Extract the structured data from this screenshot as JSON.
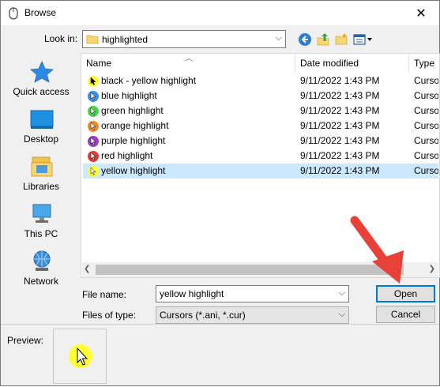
{
  "window": {
    "title": "Browse",
    "close_glyph": "✕"
  },
  "look_in": {
    "label": "Look in:",
    "value": "highlighted"
  },
  "places": [
    {
      "label": "Quick access",
      "icon": "star-icon"
    },
    {
      "label": "Desktop",
      "icon": "desktop-icon"
    },
    {
      "label": "Libraries",
      "icon": "libraries-icon"
    },
    {
      "label": "This PC",
      "icon": "pc-icon"
    },
    {
      "label": "Network",
      "icon": "network-icon"
    }
  ],
  "columns": {
    "name": "Name",
    "date": "Date modified",
    "type": "Type"
  },
  "files": [
    {
      "name": "black - yellow highlight",
      "date": "9/11/2022 1:43 PM",
      "type": "Cursor",
      "color": "#ffff33",
      "pointer": "#000000"
    },
    {
      "name": "blue highlight",
      "date": "9/11/2022 1:43 PM",
      "type": "Cursor",
      "color": "#3a8ee6",
      "pointer": "#ffffff"
    },
    {
      "name": "green highlight",
      "date": "9/11/2022 1:43 PM",
      "type": "Cursor",
      "color": "#4ad14a",
      "pointer": "#ffffff"
    },
    {
      "name": "orange highlight",
      "date": "9/11/2022 1:43 PM",
      "type": "Cursor",
      "color": "#f08a24",
      "pointer": "#ffffff"
    },
    {
      "name": "purple highlight",
      "date": "9/11/2022 1:43 PM",
      "type": "Cursor",
      "color": "#9b3cc7",
      "pointer": "#ffffff"
    },
    {
      "name": "red highlight",
      "date": "9/11/2022 1:43 PM",
      "type": "Cursor",
      "color": "#e53935",
      "pointer": "#ffffff"
    },
    {
      "name": "yellow highlight",
      "date": "9/11/2022 1:43 PM",
      "type": "Cursor",
      "color": "#ffff33",
      "pointer": "#ffffff",
      "selected": true
    }
  ],
  "file_name": {
    "label": "File name:",
    "value": "yellow highlight"
  },
  "file_type": {
    "label": "Files of type:",
    "value": "Cursors (*.ani, *.cur)"
  },
  "buttons": {
    "open": "Open",
    "cancel": "Cancel"
  },
  "preview": {
    "label": "Preview:"
  },
  "colors": {
    "selection": "#cce8ff",
    "default_button_border": "#0078d7",
    "annotation_arrow": "#e8413a"
  }
}
